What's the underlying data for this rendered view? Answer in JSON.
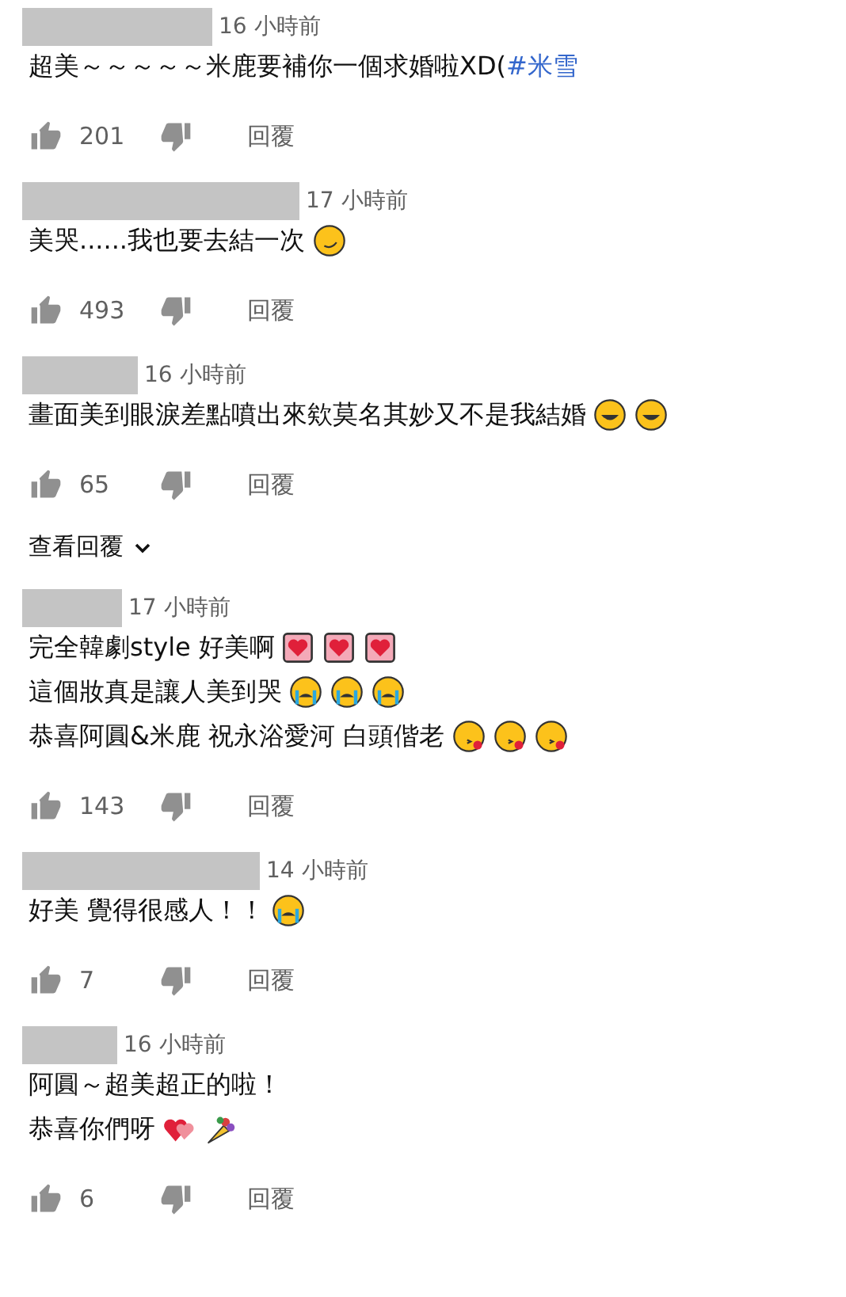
{
  "comments": [
    {
      "time": "16 小時前",
      "lines": [
        [
          {
            "kind": "text",
            "text": "超美～～～～～米鹿要補你一個求婚啦XD("
          },
          {
            "kind": "hashtag",
            "text": "#米雪"
          }
        ]
      ],
      "likes": "201",
      "reply": "回覆"
    },
    {
      "time": "17 小時前",
      "lines": [
        [
          {
            "kind": "text",
            "text": "美哭......我也要去結一次"
          },
          {
            "kind": "smirk"
          }
        ]
      ],
      "likes": "493",
      "reply": "回覆"
    },
    {
      "time": "16 小時前",
      "lines": [
        [
          {
            "kind": "text",
            "text": "畫面美到眼淚差點噴出來欸莫名其妙又不是我結婚"
          },
          {
            "kind": "laughing"
          },
          {
            "kind": "laughing"
          }
        ]
      ],
      "likes": "65",
      "reply": "回覆",
      "view_replies": "查看回覆"
    },
    {
      "time": "17 小時前",
      "lines": [
        [
          {
            "kind": "text",
            "text": "完全韓劇style 好美啊"
          },
          {
            "kind": "heartbox"
          },
          {
            "kind": "heartbox"
          },
          {
            "kind": "heartbox"
          }
        ],
        [
          {
            "kind": "text",
            "text": "這個妝真是讓人美到哭"
          },
          {
            "kind": "crying"
          },
          {
            "kind": "crying"
          },
          {
            "kind": "crying"
          }
        ],
        [
          {
            "kind": "text",
            "text": "恭喜阿圓&米鹿 祝永浴愛河 白頭偕老"
          },
          {
            "kind": "kiss"
          },
          {
            "kind": "kiss"
          },
          {
            "kind": "kiss"
          }
        ]
      ],
      "likes": "143",
      "reply": "回覆"
    },
    {
      "time": "14 小時前",
      "lines": [
        [
          {
            "kind": "text",
            "text": "好美 覺得很感人！！"
          },
          {
            "kind": "crying"
          }
        ]
      ],
      "likes": "7",
      "reply": "回覆"
    },
    {
      "time": "16 小時前",
      "lines": [
        [
          {
            "kind": "text",
            "text": "阿圓～超美超正的啦！"
          }
        ],
        [
          {
            "kind": "text",
            "text": "恭喜你們呀"
          },
          {
            "kind": "hearts"
          },
          {
            "kind": "bouquet"
          }
        ]
      ],
      "likes": "6",
      "reply": "回覆"
    }
  ]
}
